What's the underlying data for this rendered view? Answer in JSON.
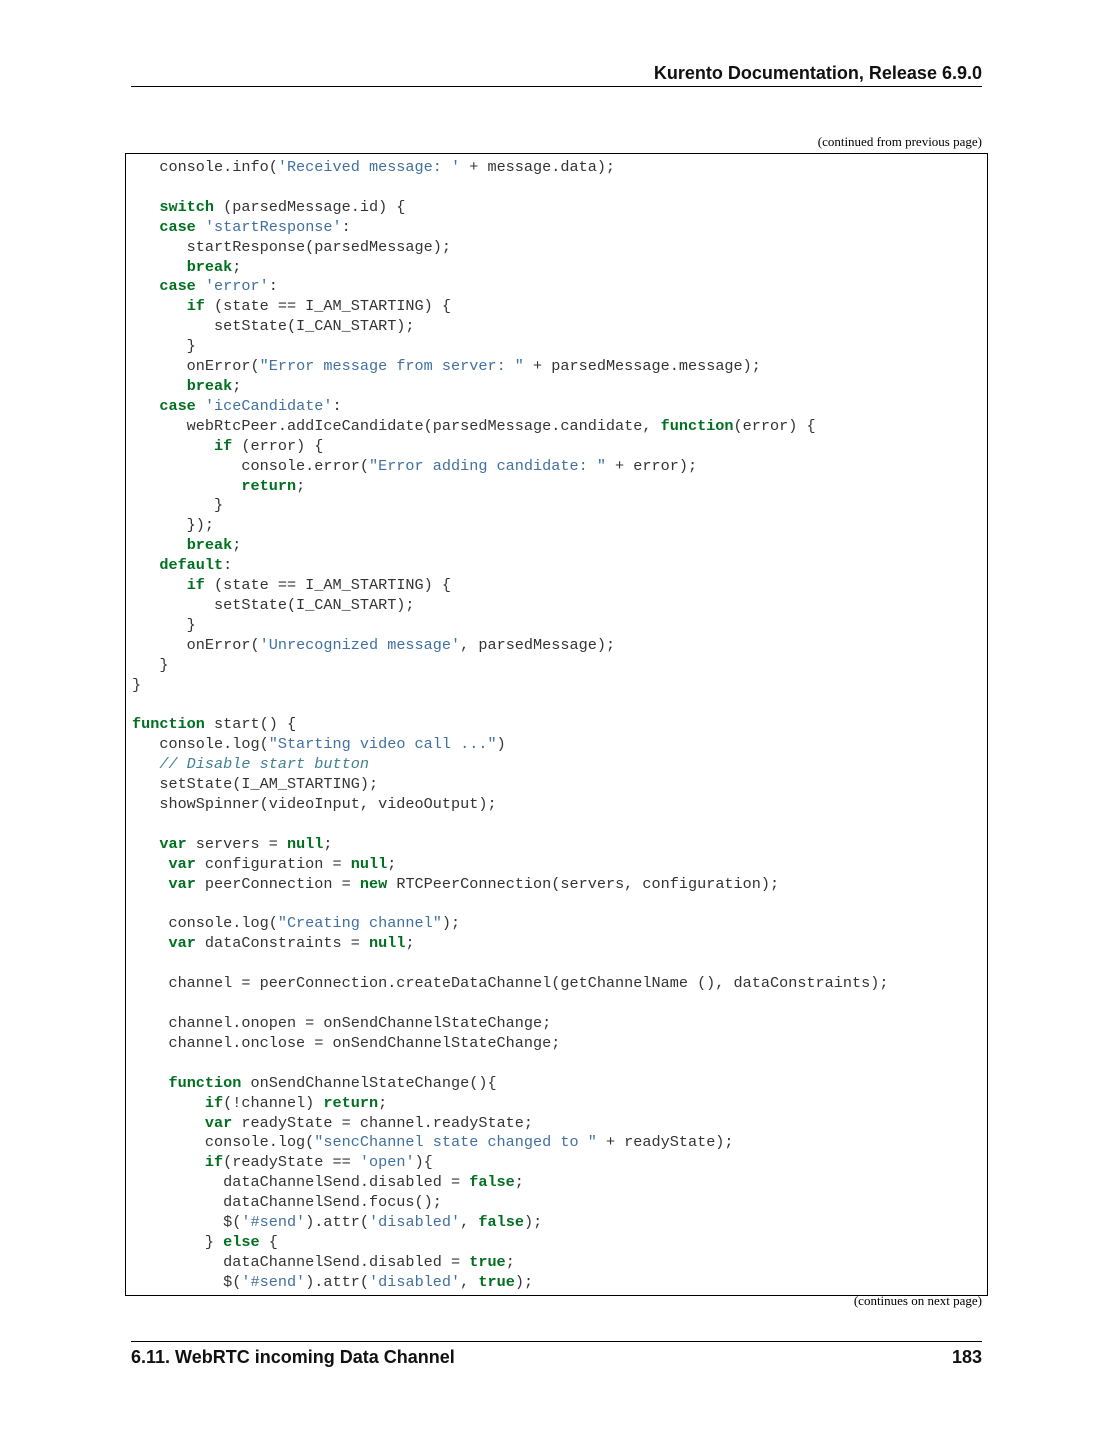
{
  "header": {
    "title": "Kurento Documentation, Release 6.9.0"
  },
  "code_block": {
    "continued_from": "(continued from previous page)",
    "continues_on": "(continues on next page)",
    "lines": [
      [
        [
          "t",
          "   console.info("
        ],
        [
          "s",
          "'Received message: '"
        ],
        [
          "t",
          " + message.data);"
        ]
      ],
      [],
      [
        [
          "t",
          "   "
        ],
        [
          "k",
          "switch"
        ],
        [
          "t",
          " (parsedMessage.id) {"
        ]
      ],
      [
        [
          "t",
          "   "
        ],
        [
          "k",
          "case"
        ],
        [
          "t",
          " "
        ],
        [
          "s",
          "'startResponse'"
        ],
        [
          "t",
          ":"
        ]
      ],
      [
        [
          "t",
          "      startResponse(parsedMessage);"
        ]
      ],
      [
        [
          "t",
          "      "
        ],
        [
          "k",
          "break"
        ],
        [
          "t",
          ";"
        ]
      ],
      [
        [
          "t",
          "   "
        ],
        [
          "k",
          "case"
        ],
        [
          "t",
          " "
        ],
        [
          "s",
          "'error'"
        ],
        [
          "t",
          ":"
        ]
      ],
      [
        [
          "t",
          "      "
        ],
        [
          "k",
          "if"
        ],
        [
          "t",
          " (state == I_AM_STARTING) {"
        ]
      ],
      [
        [
          "t",
          "         setState(I_CAN_START);"
        ]
      ],
      [
        [
          "t",
          "      }"
        ]
      ],
      [
        [
          "t",
          "      onError("
        ],
        [
          "s",
          "\"Error message from server: \""
        ],
        [
          "t",
          " + parsedMessage.message);"
        ]
      ],
      [
        [
          "t",
          "      "
        ],
        [
          "k",
          "break"
        ],
        [
          "t",
          ";"
        ]
      ],
      [
        [
          "t",
          "   "
        ],
        [
          "k",
          "case"
        ],
        [
          "t",
          " "
        ],
        [
          "s",
          "'iceCandidate'"
        ],
        [
          "t",
          ":"
        ]
      ],
      [
        [
          "t",
          "      webRtcPeer.addIceCandidate(parsedMessage.candidate, "
        ],
        [
          "k",
          "function"
        ],
        [
          "t",
          "(error) {"
        ]
      ],
      [
        [
          "t",
          "         "
        ],
        [
          "k",
          "if"
        ],
        [
          "t",
          " (error) {"
        ]
      ],
      [
        [
          "t",
          "            console.error("
        ],
        [
          "s",
          "\"Error adding candidate: \""
        ],
        [
          "t",
          " + error);"
        ]
      ],
      [
        [
          "t",
          "            "
        ],
        [
          "k",
          "return"
        ],
        [
          "t",
          ";"
        ]
      ],
      [
        [
          "t",
          "         }"
        ]
      ],
      [
        [
          "t",
          "      });"
        ]
      ],
      [
        [
          "t",
          "      "
        ],
        [
          "k",
          "break"
        ],
        [
          "t",
          ";"
        ]
      ],
      [
        [
          "t",
          "   "
        ],
        [
          "k",
          "default"
        ],
        [
          "t",
          ":"
        ]
      ],
      [
        [
          "t",
          "      "
        ],
        [
          "k",
          "if"
        ],
        [
          "t",
          " (state == I_AM_STARTING) {"
        ]
      ],
      [
        [
          "t",
          "         setState(I_CAN_START);"
        ]
      ],
      [
        [
          "t",
          "      }"
        ]
      ],
      [
        [
          "t",
          "      onError("
        ],
        [
          "s",
          "'Unrecognized message'"
        ],
        [
          "t",
          ", parsedMessage);"
        ]
      ],
      [
        [
          "t",
          "   }"
        ]
      ],
      [
        [
          "t",
          "}"
        ]
      ],
      [],
      [
        [
          "k",
          "function"
        ],
        [
          "t",
          " start() {"
        ]
      ],
      [
        [
          "t",
          "   console.log("
        ],
        [
          "s",
          "\"Starting video call ...\""
        ],
        [
          "t",
          ")"
        ]
      ],
      [
        [
          "t",
          "   "
        ],
        [
          "c",
          "// Disable start button"
        ]
      ],
      [
        [
          "t",
          "   setState(I_AM_STARTING);"
        ]
      ],
      [
        [
          "t",
          "   showSpinner(videoInput, videoOutput);"
        ]
      ],
      [],
      [
        [
          "t",
          "   "
        ],
        [
          "k",
          "var"
        ],
        [
          "t",
          " servers = "
        ],
        [
          "k",
          "null"
        ],
        [
          "t",
          ";"
        ]
      ],
      [
        [
          "t",
          "    "
        ],
        [
          "k",
          "var"
        ],
        [
          "t",
          " configuration = "
        ],
        [
          "k",
          "null"
        ],
        [
          "t",
          ";"
        ]
      ],
      [
        [
          "t",
          "    "
        ],
        [
          "k",
          "var"
        ],
        [
          "t",
          " peerConnection = "
        ],
        [
          "k",
          "new"
        ],
        [
          "t",
          " RTCPeerConnection(servers, configuration);"
        ]
      ],
      [],
      [
        [
          "t",
          "    console.log("
        ],
        [
          "s",
          "\"Creating channel\""
        ],
        [
          "t",
          ");"
        ]
      ],
      [
        [
          "t",
          "    "
        ],
        [
          "k",
          "var"
        ],
        [
          "t",
          " dataConstraints = "
        ],
        [
          "k",
          "null"
        ],
        [
          "t",
          ";"
        ]
      ],
      [],
      [
        [
          "t",
          "    channel = peerConnection.createDataChannel(getChannelName (), dataConstraints);"
        ]
      ],
      [],
      [
        [
          "t",
          "    channel.onopen = onSendChannelStateChange;"
        ]
      ],
      [
        [
          "t",
          "    channel.onclose = onSendChannelStateChange;"
        ]
      ],
      [],
      [
        [
          "t",
          "    "
        ],
        [
          "k",
          "function"
        ],
        [
          "t",
          " onSendChannelStateChange(){"
        ]
      ],
      [
        [
          "t",
          "        "
        ],
        [
          "k",
          "if"
        ],
        [
          "t",
          "(!channel) "
        ],
        [
          "k",
          "return"
        ],
        [
          "t",
          ";"
        ]
      ],
      [
        [
          "t",
          "        "
        ],
        [
          "k",
          "var"
        ],
        [
          "t",
          " readyState = channel.readyState;"
        ]
      ],
      [
        [
          "t",
          "        console.log("
        ],
        [
          "s",
          "\"sencChannel state changed to \""
        ],
        [
          "t",
          " + readyState);"
        ]
      ],
      [
        [
          "t",
          "        "
        ],
        [
          "k",
          "if"
        ],
        [
          "t",
          "(readyState == "
        ],
        [
          "s",
          "'open'"
        ],
        [
          "t",
          "){"
        ]
      ],
      [
        [
          "t",
          "          dataChannelSend.disabled = "
        ],
        [
          "k",
          "false"
        ],
        [
          "t",
          ";"
        ]
      ],
      [
        [
          "t",
          "          dataChannelSend.focus();"
        ]
      ],
      [
        [
          "t",
          "          $("
        ],
        [
          "s",
          "'#send'"
        ],
        [
          "t",
          ").attr("
        ],
        [
          "s",
          "'disabled'"
        ],
        [
          "t",
          ", "
        ],
        [
          "k",
          "false"
        ],
        [
          "t",
          ");"
        ]
      ],
      [
        [
          "t",
          "        } "
        ],
        [
          "k",
          "else"
        ],
        [
          "t",
          " {"
        ]
      ],
      [
        [
          "t",
          "          dataChannelSend.disabled = "
        ],
        [
          "k",
          "true"
        ],
        [
          "t",
          ";"
        ]
      ],
      [
        [
          "t",
          "          $("
        ],
        [
          "s",
          "'#send'"
        ],
        [
          "t",
          ").attr("
        ],
        [
          "s",
          "'disabled'"
        ],
        [
          "t",
          ", "
        ],
        [
          "k",
          "true"
        ],
        [
          "t",
          ");"
        ]
      ]
    ]
  },
  "footer": {
    "section": "6.11.  WebRTC incoming Data Channel",
    "page_number": "183"
  },
  "colors": {
    "keyword": "#007020",
    "string": "#4070a0",
    "comment": "#408090",
    "text": "#333333"
  }
}
